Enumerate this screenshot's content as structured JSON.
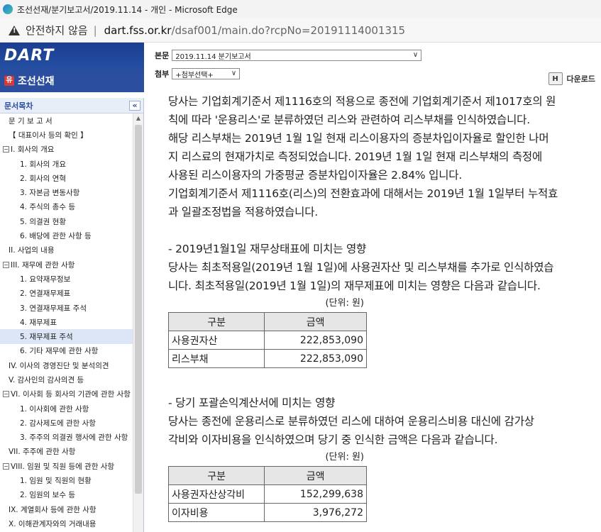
{
  "window": {
    "title": "조선선재/분기보고서/2019.11.14 - 개인 - Microsoft Edge"
  },
  "address_bar": {
    "security_text": "안전하지 않음",
    "url_host": "dart.fss.or.kr",
    "url_path": "/dsaf001/main.do?rcpNo=20191114001315"
  },
  "header": {
    "logo": "DART",
    "company": "조선선재",
    "company_icon": "유",
    "body_label": "본문",
    "body_value": "2019.11.14  분기보고서",
    "attach_label": "첨부",
    "attach_value": "+첨부선택+",
    "download_label": "다운로드"
  },
  "sidebar": {
    "title": "문서목차",
    "collapse": "«",
    "items": [
      {
        "label": "문 기 보 고 서",
        "indent": 1,
        "toggle": false,
        "selected": false
      },
      {
        "label": "【 대표이사 등의 확인 】",
        "indent": 1,
        "toggle": false,
        "selected": false
      },
      {
        "label": "I. 회사의 개요",
        "indent": 0,
        "toggle": true,
        "selected": false
      },
      {
        "label": "1. 회사의 개요",
        "indent": 3,
        "toggle": false,
        "selected": false
      },
      {
        "label": "2. 회사의 연혁",
        "indent": 3,
        "toggle": false,
        "selected": false
      },
      {
        "label": "3. 자본금 변동사항",
        "indent": 3,
        "toggle": false,
        "selected": false
      },
      {
        "label": "4. 주식의 총수 등",
        "indent": 3,
        "toggle": false,
        "selected": false
      },
      {
        "label": "5. 의결권 현황",
        "indent": 3,
        "toggle": false,
        "selected": false
      },
      {
        "label": "6. 배당에 관한 사항 등",
        "indent": 3,
        "toggle": false,
        "selected": false
      },
      {
        "label": "II. 사업의 내용",
        "indent": 1,
        "toggle": false,
        "selected": false
      },
      {
        "label": "III. 재무에 관한 사항",
        "indent": 0,
        "toggle": true,
        "selected": false
      },
      {
        "label": "1. 요약재무정보",
        "indent": 3,
        "toggle": false,
        "selected": false
      },
      {
        "label": "2. 연결재무제표",
        "indent": 3,
        "toggle": false,
        "selected": false
      },
      {
        "label": "3. 연결재무제표 주석",
        "indent": 3,
        "toggle": false,
        "selected": false
      },
      {
        "label": "4. 재무제표",
        "indent": 3,
        "toggle": false,
        "selected": false
      },
      {
        "label": "5. 재무제표 주석",
        "indent": 3,
        "toggle": false,
        "selected": true
      },
      {
        "label": "6. 기타 재무에 관한 사항",
        "indent": 3,
        "toggle": false,
        "selected": false
      },
      {
        "label": "IV. 이사의 경영진단 및 분석의견",
        "indent": 1,
        "toggle": false,
        "selected": false
      },
      {
        "label": "V. 감사인의 감사의견 등",
        "indent": 1,
        "toggle": false,
        "selected": false
      },
      {
        "label": "VI. 이사회 등 회사의 기관에 관한 사항",
        "indent": 0,
        "toggle": true,
        "selected": false
      },
      {
        "label": "1. 이사회에 관한 사항",
        "indent": 3,
        "toggle": false,
        "selected": false
      },
      {
        "label": "2. 감사제도에 관한 사항",
        "indent": 3,
        "toggle": false,
        "selected": false
      },
      {
        "label": "3. 주주의 의결권 행사에 관한 사항",
        "indent": 3,
        "toggle": false,
        "selected": false
      },
      {
        "label": "VII. 주주에 관한 사항",
        "indent": 1,
        "toggle": false,
        "selected": false
      },
      {
        "label": "VIII. 임원 및 직원 등에 관한 사항",
        "indent": 0,
        "toggle": true,
        "selected": false
      },
      {
        "label": "1. 임원 및 직원의 현황",
        "indent": 3,
        "toggle": false,
        "selected": false
      },
      {
        "label": "2. 임원의 보수 등",
        "indent": 3,
        "toggle": false,
        "selected": false
      },
      {
        "label": "IX. 계열회사 등에 관한 사항",
        "indent": 1,
        "toggle": false,
        "selected": false
      },
      {
        "label": "X. 이해관계자와의 거래내용",
        "indent": 1,
        "toggle": false,
        "selected": false
      }
    ]
  },
  "content": {
    "intro": [
      "당사는 기업회계기준서 제1116호의 적용으로 종전에 기업회계기준서 제1017호의 원",
      "칙에 따라 '운용리스'로 분류하였던 리스와 관련하여 리스부채를 인식하였습니다.",
      "해당 리스부채는 2019년 1월 1일 현재 리스이용자의 증분차입이자율로 할인한 나머",
      "지 리스료의 현재가치로 측정되었습니다. 2019년 1월 1일 현재 리스부채의 측정에",
      "사용된 리스이용자의 가중평균 증분차입이자율은 2.84% 입니다.",
      "기업회계기준서 제1116호(리스)의 전환효과에 대해서는 2019년 1월 1일부터 누적효",
      "과 일괄조정법을 적용하였습니다."
    ],
    "section1": {
      "heading": "- 2019년1월1일 재무상태표에 미치는 영향",
      "text": [
        "당사는 최초적용일(2019년 1월 1일)에 사용권자산 및 리스부채를 추가로 인식하였습",
        "니다. 최초적용일(2019년 1월 1일)의 재무제표에 미치는 영향은 다음과 같습니다."
      ],
      "unit": "(단위: 원)",
      "table": {
        "headers": [
          "구분",
          "금액"
        ],
        "rows": [
          [
            "사용권자산",
            "222,853,090"
          ],
          [
            "리스부채",
            "222,853,090"
          ]
        ]
      }
    },
    "section2": {
      "heading": "- 당기 포괄손익계산서에 미치는 영향",
      "text": [
        "당사는 종전에 운용리스로 분류하였던 리스에 대하여 운용리스비용 대신에 감가상",
        "각비와 이자비용을 인식하였으며 당기 중 인식한 금액은 다음과 같습니다."
      ],
      "unit": "(단위: 원)",
      "table": {
        "headers": [
          "구분",
          "금액"
        ],
        "rows": [
          [
            "사용권자산상각비",
            "152,299,638"
          ],
          [
            "이자비용",
            "3,976,272"
          ]
        ]
      }
    }
  }
}
